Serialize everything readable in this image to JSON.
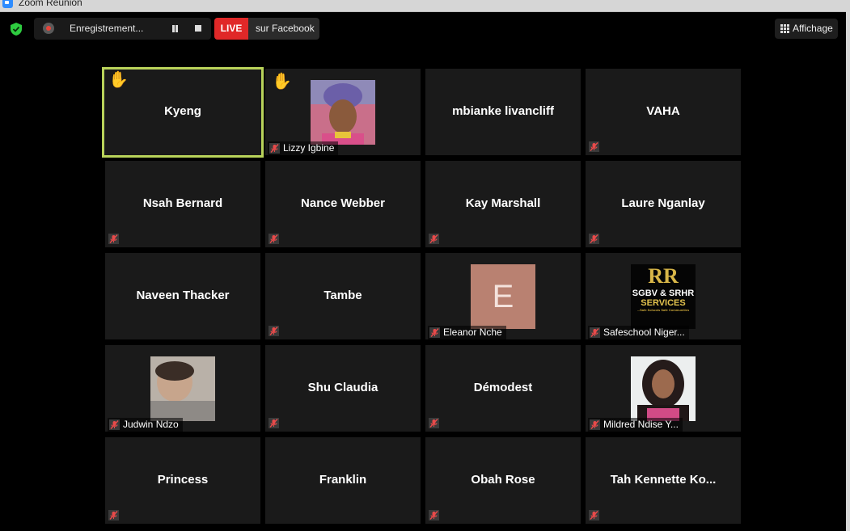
{
  "window": {
    "title": "Zoom Réunion"
  },
  "toolbar": {
    "recording_label": "Enregistrement...",
    "live_badge": "LIVE",
    "live_destination": "sur Facebook",
    "view_label": "Affichage"
  },
  "accent": {
    "active_speaker_border": "#b9d35a",
    "live_red": "#e02828",
    "shield_green": "#2ecc40"
  },
  "participants": [
    {
      "name": "Kyeng",
      "hand_raised": true,
      "active_speaker": true
    },
    {
      "name": "Lizzy Igbine",
      "hand_raised": true,
      "muted": true,
      "video": "photo"
    },
    {
      "name": "mbianke livancliff"
    },
    {
      "name": "VAHA",
      "muted": true
    },
    {
      "name": "Nsah Bernard",
      "muted": true
    },
    {
      "name": "Nance Webber",
      "muted": true
    },
    {
      "name": "Kay Marshall",
      "muted": true
    },
    {
      "name": "Laure Nganlay",
      "muted": true
    },
    {
      "name": "Naveen Thacker"
    },
    {
      "name": "Tambe",
      "muted": true
    },
    {
      "name": "Eleanor Nche",
      "muted": true,
      "video": "letter",
      "avatar_letter": "E"
    },
    {
      "name": "Safeschool Niger...",
      "muted": true,
      "video": "logo",
      "logo_text": {
        "l1": "RR",
        "l2": "SGBV & SRHR",
        "l3": "SERVICES",
        "l4": "...Safe Schools Safe Communities"
      }
    },
    {
      "name": "Judwin Ndzo",
      "muted": true,
      "video": "photo"
    },
    {
      "name": "Shu Claudia",
      "muted": true
    },
    {
      "name": "Démodest",
      "muted": true
    },
    {
      "name": "Mildred Ndise Y...",
      "muted": true,
      "video": "photo"
    },
    {
      "name": "Princess",
      "muted": true
    },
    {
      "name": "Franklin"
    },
    {
      "name": "Obah Rose",
      "muted": true
    },
    {
      "name": "Tah Kennette Ko...",
      "muted": true
    }
  ]
}
